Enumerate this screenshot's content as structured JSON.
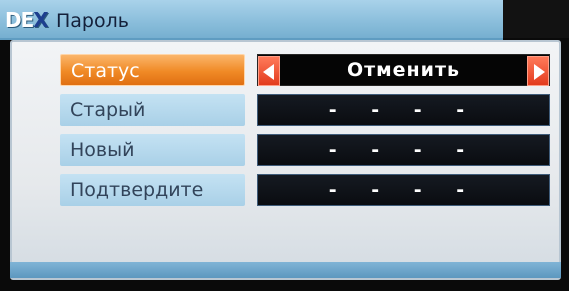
{
  "header": {
    "logo": "DEX",
    "logo_prefix": "DE",
    "logo_x": "X",
    "title": "Пароль"
  },
  "rows": [
    {
      "label": "Статус",
      "value": "Отменить",
      "active": true
    },
    {
      "label": "Старый",
      "value": "- - - -",
      "active": false
    },
    {
      "label": "Новый",
      "value": "- - - -",
      "active": false
    },
    {
      "label": "Подтвердите",
      "value": "- - - -",
      "active": false
    }
  ],
  "colors": {
    "title_bar": "#8cbfdc",
    "active_label": "#f08a26",
    "inactive_label": "#b8d9ee",
    "arrow": "#e23b1d",
    "value_field": "#0a0c10"
  },
  "icons": {
    "arrow_left": "left-arrow-icon",
    "arrow_right": "right-arrow-icon"
  }
}
